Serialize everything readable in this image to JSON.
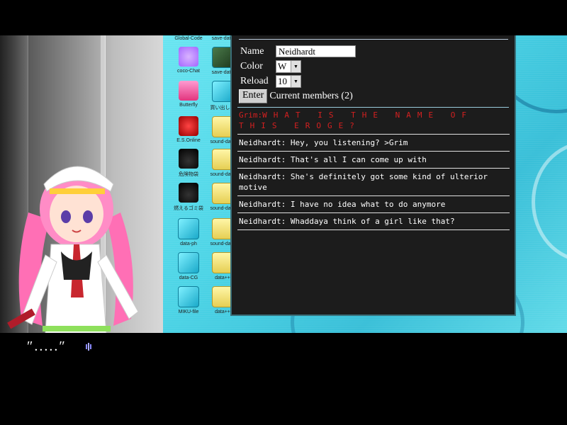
{
  "desktop": {
    "icons": [
      {
        "label": "Global-Code",
        "icon": "global-code-icon"
      },
      {
        "label": "save-data",
        "icon": "save-data-icon"
      },
      {
        "label": "coco-Chat",
        "icon": "coco-chat-icon"
      },
      {
        "label": "save-data",
        "icon": "save-data-icon"
      },
      {
        "label": "Butterfly",
        "icon": "butterfly-icon"
      },
      {
        "label": "買い出しリ",
        "icon": "shopping-list-icon"
      },
      {
        "label": "E.S.Online",
        "icon": "es-online-icon"
      },
      {
        "label": "sound-data",
        "icon": "sound-data-icon"
      },
      {
        "label": "危険物袋",
        "icon": "hazard-bag-icon"
      },
      {
        "label": "sound-data",
        "icon": "sound-data-icon"
      },
      {
        "label": "燃えるゴミ袋",
        "icon": "burnable-trash-icon"
      },
      {
        "label": "sound-data",
        "icon": "sound-data-icon"
      },
      {
        "label": "data-ph",
        "icon": "data-cube-icon"
      },
      {
        "label": "sound-data",
        "icon": "sound-data-icon"
      },
      {
        "label": "data-CG",
        "icon": "data-cube-icon"
      },
      {
        "label": "data++",
        "icon": "data-cube-icon"
      },
      {
        "label": "MIKU-file",
        "icon": "data-cube-icon"
      },
      {
        "label": "data++",
        "icon": "data-cube-icon"
      }
    ]
  },
  "chat": {
    "name_label": "Name",
    "name_value": "Neidhardt",
    "color_label": "Color",
    "color_value": "W",
    "reload_label": "Reload",
    "reload_value": "10",
    "enter_label": "Enter",
    "members_text": "Current members (2)",
    "messages": [
      {
        "who": "Grim:",
        "text": "WHAT IS THE NAME OF THIS EROGE?",
        "color": "#d42020"
      },
      {
        "who": "Neidhardt:",
        "text": "Hey, you listening? >Grim",
        "color": "#ffffff"
      },
      {
        "who": "Neidhardt:",
        "text": "That's all I can come up with",
        "color": "#ffffff"
      },
      {
        "who": "Neidhardt:",
        "text": "She's definitely got some kind of ulterior motive",
        "color": "#ffffff"
      },
      {
        "who": "Neidhardt:",
        "text": "I have no idea what to do anymore",
        "color": "#ffffff"
      },
      {
        "who": "Neidhardt:",
        "text": "Whaddaya think of a girl like that?",
        "color": "#ffffff"
      }
    ]
  },
  "dialogue": {
    "text": "″.....″",
    "wait_icon": "text-wait-icon"
  },
  "colors": {
    "desktop_bg": "#4cd4e6",
    "chat_bg": "#1c1c1c",
    "accent_red": "#d42020"
  }
}
